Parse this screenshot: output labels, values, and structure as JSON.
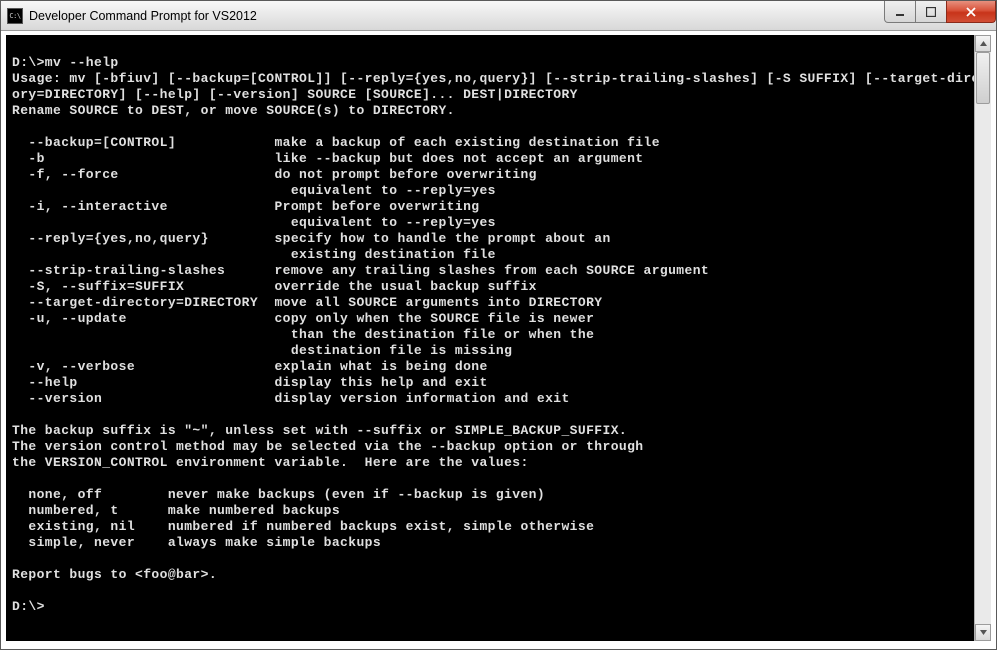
{
  "window": {
    "icon_label": "C:\\",
    "title": "Developer Command Prompt for VS2012"
  },
  "terminal": {
    "prompt1": "D:\\>mv --help",
    "usage_l1": "Usage: mv [-bfiuv] [--backup=[CONTROL]] [--reply={yes,no,query}] [--strip-trailing-slashes] [-S SUFFIX] [--target-direct",
    "usage_l2": "ory=DIRECTORY] [--help] [--version] SOURCE [SOURCE]... DEST|DIRECTORY",
    "rename": "Rename SOURCE to DEST, or move SOURCE(s) to DIRECTORY.",
    "opt_backup_f": "  --backup=[CONTROL]",
    "opt_backup_d": "make a backup of each existing destination file",
    "opt_b_f": "  -b",
    "opt_b_d": "like --backup but does not accept an argument",
    "opt_f_f": "  -f, --force",
    "opt_f_d": "do not prompt before overwriting",
    "opt_f_d2": "  equivalent to --reply=yes",
    "opt_i_f": "  -i, --interactive",
    "opt_i_d": "Prompt before overwriting",
    "opt_i_d2": "  equivalent to --reply=yes",
    "opt_reply_f": "  --reply={yes,no,query}",
    "opt_reply_d": "specify how to handle the prompt about an",
    "opt_reply_d2": "  existing destination file",
    "opt_strip_f": "  --strip-trailing-slashes",
    "opt_strip_d": "remove any trailing slashes from each SOURCE argument",
    "opt_S_f": "  -S, --suffix=SUFFIX",
    "opt_S_d": "override the usual backup suffix",
    "opt_target_f": "  --target-directory=DIRECTORY",
    "opt_target_d": "move all SOURCE arguments into DIRECTORY",
    "opt_u_f": "  -u, --update",
    "opt_u_d": "copy only when the SOURCE file is newer",
    "opt_u_d2": "  than the destination file or when the",
    "opt_u_d3": "  destination file is missing",
    "opt_v_f": "  -v, --verbose",
    "opt_v_d": "explain what is being done",
    "opt_help_f": "  --help",
    "opt_help_d": "display this help and exit",
    "opt_ver_f": "  --version",
    "opt_ver_d": "display version information and exit",
    "suffix_l1": "The backup suffix is \"~\", unless set with --suffix or SIMPLE_BACKUP_SUFFIX.",
    "suffix_l2": "The version control method may be selected via the --backup option or through",
    "suffix_l3": "the VERSION_CONTROL environment variable.  Here are the values:",
    "vc_none_k": "  none, off",
    "vc_none_v": "never make backups (even if --backup is given)",
    "vc_num_k": "  numbered, t",
    "vc_num_v": "make numbered backups",
    "vc_exist_k": "  existing, nil",
    "vc_exist_v": "numbered if numbered backups exist, simple otherwise",
    "vc_simple_k": "  simple, never",
    "vc_simple_v": "always make simple backups",
    "report": "Report bugs to <foo@bar>.",
    "prompt2": "D:\\>",
    "opt_col": 32,
    "vc_col": 19
  }
}
